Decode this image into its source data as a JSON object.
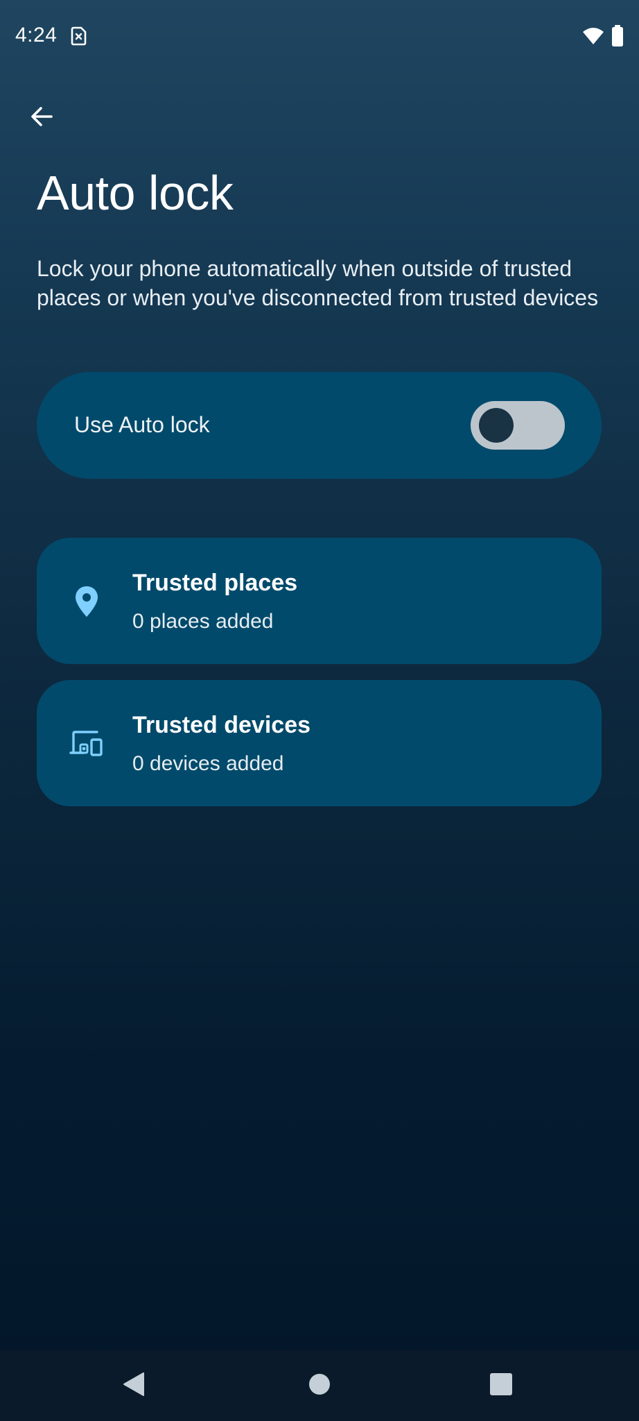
{
  "status_bar": {
    "time": "4:24",
    "icons": [
      "sim-card-icon",
      "wifi-icon",
      "battery-icon"
    ]
  },
  "header": {
    "back_icon": "arrow-back-icon",
    "title": "Auto lock"
  },
  "description": "Lock your phone automatically when outside of trusted places or when you've disconnected from trusted devices",
  "toggle": {
    "label": "Use Auto lock",
    "checked": false
  },
  "items": [
    {
      "icon": "location-pin-icon",
      "title": "Trusted places",
      "subtitle": "0 places added"
    },
    {
      "icon": "devices-icon",
      "title": "Trusted devices",
      "subtitle": "0 devices added"
    }
  ],
  "nav_bar": {
    "icons": [
      "nav-back-icon",
      "nav-home-icon",
      "nav-recents-icon"
    ]
  },
  "colors": {
    "card": "#024a6b",
    "toggle_track": "#bcc5cc",
    "toggle_thumb": "#193244",
    "accent_icon": "#7fd0ff",
    "nav_bar": "#0b1a2a"
  }
}
